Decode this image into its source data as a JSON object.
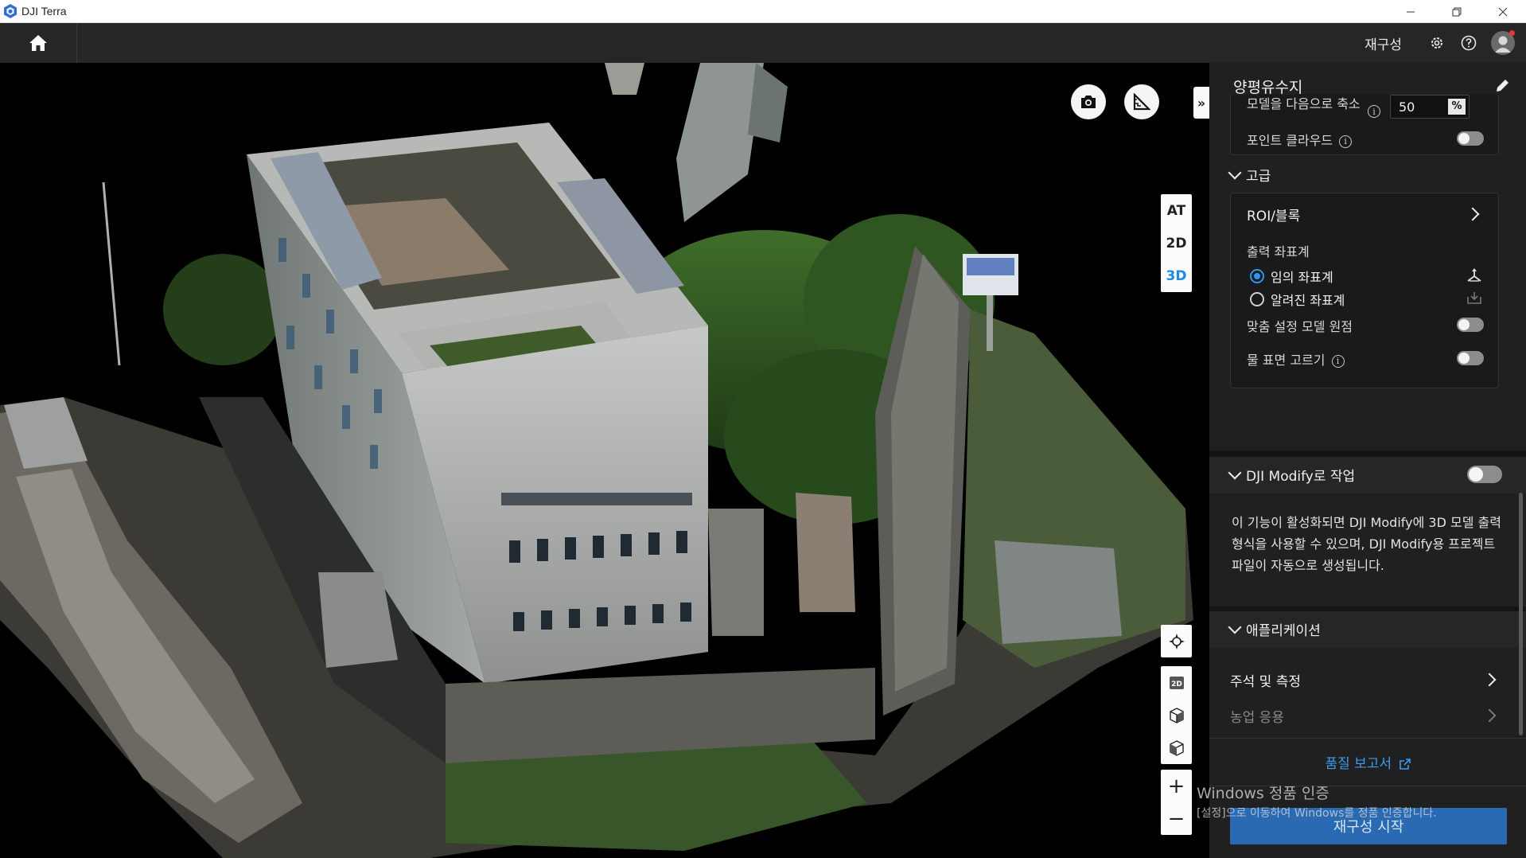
{
  "window": {
    "title": "DJI Terra"
  },
  "header": {
    "tab_label": "재구성"
  },
  "viewport": {
    "modes": [
      "AT",
      "2D",
      "3D"
    ],
    "active_mode": "3D",
    "tools": [
      "2D"
    ],
    "zoom_in": "+",
    "zoom_out": "−"
  },
  "panel": {
    "title": "양평유수지",
    "scale_label": "모델을 다음으로 축소",
    "scale_value": "50",
    "scale_unit": "%",
    "point_cloud_label": "포인트 클라우드",
    "advanced": {
      "title": "고급",
      "roi_label": "ROI/블록",
      "output_coord_label": "출력 좌표계",
      "coord_options": [
        "임의 좌표계",
        "알려진 좌표계"
      ],
      "custom_origin_label": "맞춤 설정 모델 원점",
      "water_surface_label": "물 표면 고르기"
    },
    "modify": {
      "title": "DJI Modify로 작업",
      "description": "이 기능이 활성화되면 DJI Modify에 3D 모델 출력 형식을 사용할 수 있으며, DJI Modify용 프로젝트 파일이 자동으로 생성됩니다."
    },
    "applications": {
      "title": "애플리케이션",
      "items": [
        "주석 및 측정",
        "농업 응용"
      ]
    },
    "quality_report": "품질 보고서",
    "start_button": "재구성 시작"
  },
  "watermark": {
    "line1": "Windows 정품 인증",
    "line2": "[설정]으로 이동하여 Windows를 정품 인증합니다."
  },
  "colors": {
    "accent": "#2e95f0",
    "panel_bg": "#202020",
    "header_bg": "#262626"
  }
}
